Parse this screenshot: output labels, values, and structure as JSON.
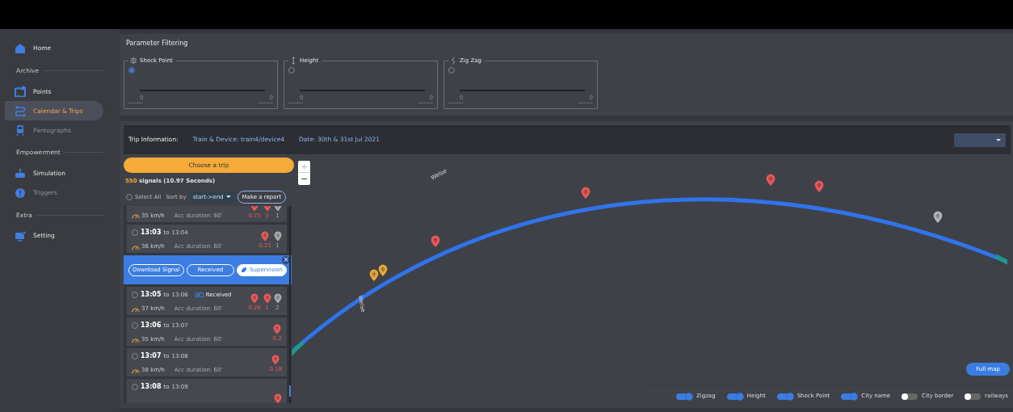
{
  "sidebar": [
    {
      "items": [
        {
          "label": "Home",
          "selected": false,
          "disabled": false
        }
      ]
    },
    {
      "heading": "Archive",
      "items": [
        {
          "label": "Points",
          "selected": false,
          "disabled": false
        },
        {
          "label": "Calendar & Trips",
          "selected": true,
          "disabled": false
        },
        {
          "label": "Pantographs",
          "selected": false,
          "disabled": true
        }
      ]
    },
    {
      "heading": "Empowerment",
      "items": [
        {
          "label": "Simulation",
          "selected": false,
          "disabled": false
        },
        {
          "label": "Triggers",
          "selected": false,
          "disabled": true
        }
      ]
    },
    {
      "heading": "Extra",
      "items": [
        {
          "label": "Setting",
          "selected": false,
          "disabled": false
        }
      ]
    }
  ],
  "filtering": {
    "title": "Parameter Filtering",
    "filters": [
      {
        "label": "Shock Point",
        "checked": true,
        "min": "0",
        "max": "0"
      },
      {
        "label": "Height",
        "checked": false,
        "min": "0",
        "max": "0"
      },
      {
        "label": "Zig Zag",
        "checked": false,
        "min": "0",
        "max": "0"
      }
    ]
  },
  "trip_info": {
    "label": "Trip Information:",
    "device": "Train & Device: train4/device4",
    "date": "Date: 30th & 31st Jul 2021"
  },
  "choose_button": "Choose a trip",
  "signals": {
    "count": "550",
    "label": "signals (10.97 Seconds)"
  },
  "select_all": {
    "label": "Select All",
    "checked": false
  },
  "sort": {
    "label": "Sort by",
    "value": "start->end"
  },
  "report_button": "Make a report",
  "trips": [
    {
      "kind": "trip",
      "speed": "35 km/h",
      "duration": "Acc duration: 60'",
      "markers": [
        {
          "color": "#e85a5a",
          "value": "0.25"
        },
        {
          "color": "#e85a5a",
          "value": "3"
        },
        {
          "color": "#a9a9a9",
          "value": "1"
        }
      ]
    },
    {
      "kind": "trip",
      "checked": false,
      "start": "13:03",
      "to": "to",
      "end": "13:04",
      "speed": "36 km/h",
      "duration": "Acc duration: 60'",
      "markers": [
        {
          "color": "#e85a5a",
          "value": "0.21"
        },
        {
          "color": "#a9a9a9",
          "value": "1"
        }
      ]
    },
    {
      "kind": "actions",
      "close": "×",
      "buttons": [
        {
          "label": "Download Signal",
          "kind": "outline"
        },
        {
          "label": "Received",
          "kind": "outline"
        },
        {
          "label": "Supervision",
          "kind": "filled"
        }
      ]
    },
    {
      "kind": "trip",
      "checked": false,
      "start": "13:05",
      "to": "to",
      "end": "13:06",
      "received": "Received",
      "speed": "37 km/h",
      "duration": "Acc duration: 60'",
      "markers": [
        {
          "color": "#e85a5a",
          "value": "0.26"
        },
        {
          "color": "#e85a5a",
          "value": "1"
        },
        {
          "color": "#a9a9a9",
          "value": "2"
        }
      ]
    },
    {
      "kind": "trip",
      "checked": false,
      "start": "13:06",
      "to": "to",
      "end": "13:07",
      "speed": "35 km/h",
      "duration": "Acc duration: 60'",
      "markers": [
        {
          "color": "#e85a5a",
          "value": "0.2"
        }
      ]
    },
    {
      "kind": "trip",
      "checked": false,
      "start": "13:07",
      "to": "to",
      "end": "13:08",
      "speed": "38 km/h",
      "duration": "Acc duration: 60'",
      "markers": [
        {
          "color": "#e85a5a",
          "value": "0.18"
        }
      ]
    },
    {
      "kind": "trip",
      "checked": false,
      "start": "13:08",
      "to": "to",
      "end": "13:09",
      "markers": [
        {
          "color": "#e85a5a"
        }
      ]
    }
  ],
  "map": {
    "zoom_in": "+",
    "zoom_out": "−",
    "labels": [
      "Welse",
      "Welse"
    ],
    "markers": [
      {
        "color": "#e8a93a"
      },
      {
        "color": "#e8a93a"
      },
      {
        "color": "#e85a5a"
      },
      {
        "color": "#e85a5a"
      },
      {
        "color": "#e85a5a"
      },
      {
        "color": "#e85a5a"
      },
      {
        "color": "#b5b5b5"
      }
    ],
    "full_map_button": "Full map",
    "layers": [
      {
        "label": "Zigzag",
        "on": true
      },
      {
        "label": "Height",
        "on": true
      },
      {
        "label": "Shock Point",
        "on": true
      },
      {
        "label": "City name",
        "on": true
      },
      {
        "label": "City border",
        "on": false
      },
      {
        "label": "railways",
        "on": false
      }
    ]
  }
}
